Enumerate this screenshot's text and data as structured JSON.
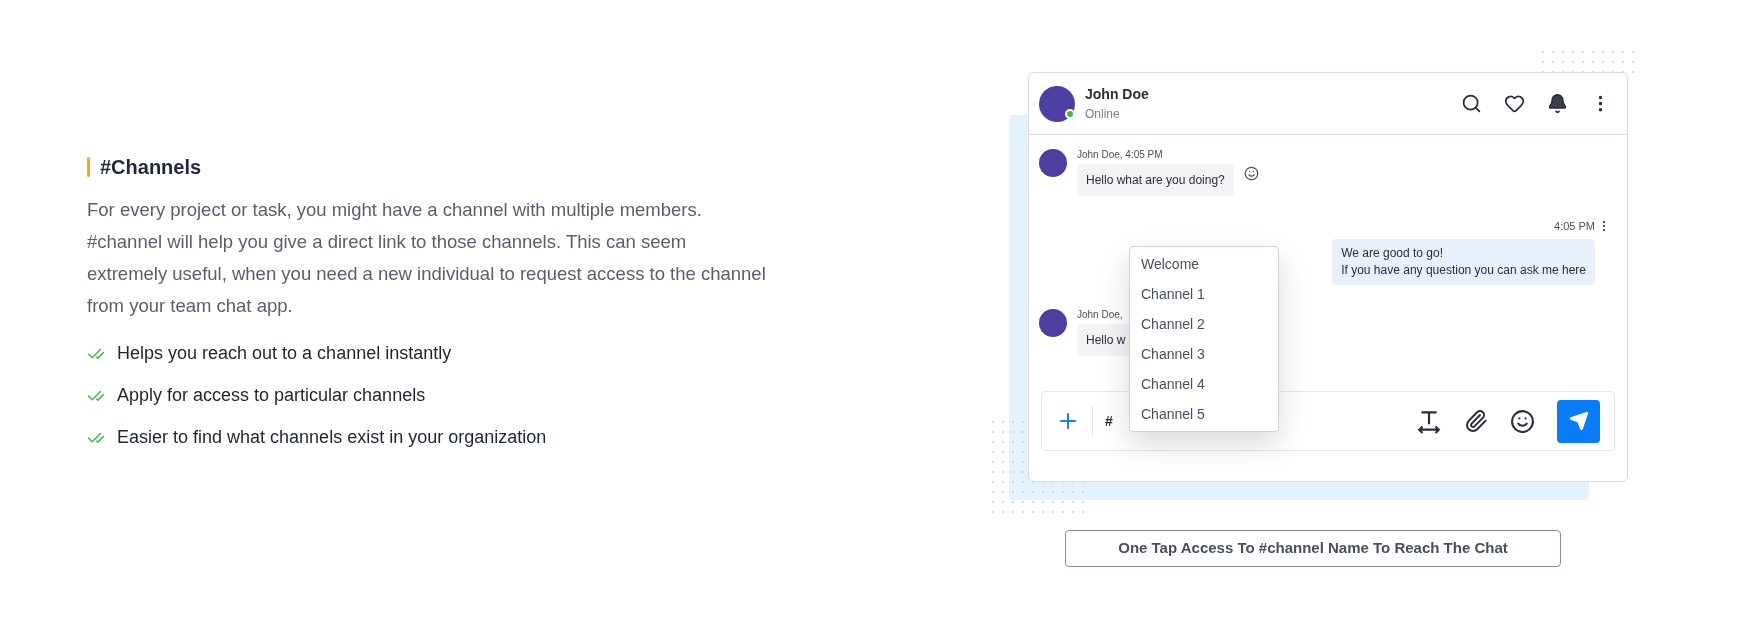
{
  "feature": {
    "heading": "#Channels",
    "description": "For every project or task, you might have a channel with multiple members. #channel will help you give a direct link to those channels. This can seem extremely useful, when you need a new individual to request access to the channel from your team chat app.",
    "points": [
      "Helps you reach out to a channel instantly",
      "Apply for access to particular channels",
      "Easier to find what channels exist in your organization"
    ]
  },
  "chat": {
    "contact": {
      "name": "John Doe",
      "status": "Online",
      "online": true
    },
    "messages": [
      {
        "kind": "incoming",
        "meta": "John Doe, 4:05 PM",
        "lines": [
          "Hello what are you doing?"
        ],
        "reaction": true
      },
      {
        "kind": "outgoing",
        "meta": "4:05 PM",
        "lines": [
          "We are good to go!",
          "If you have any question you can ask me here"
        ],
        "reaction": false
      },
      {
        "kind": "incoming",
        "meta": "John Doe,",
        "lines": [
          "Hello w"
        ],
        "reaction": false
      }
    ],
    "composer": {
      "value": "#"
    },
    "suggestions": [
      "Welcome",
      "Channel 1",
      "Channel 2",
      "Channel 3",
      "Channel 4",
      "Channel 5"
    ]
  },
  "caption": "One Tap Access To #channel Name To Reach The Chat"
}
